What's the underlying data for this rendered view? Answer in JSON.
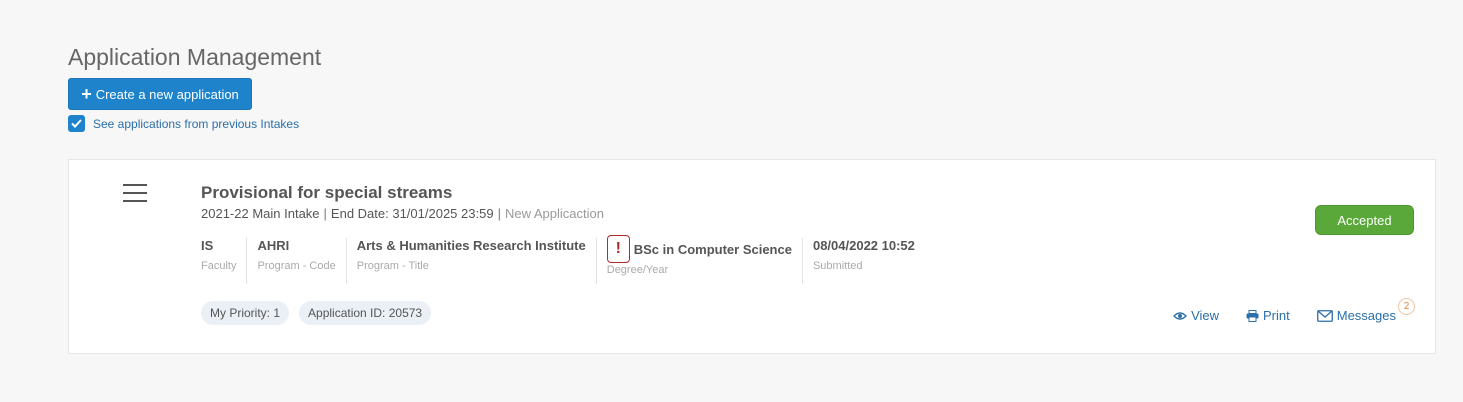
{
  "page": {
    "title": "Application Management"
  },
  "toolbar": {
    "create_label": "Create a new application",
    "prev_intakes_label": "See applications from previous Intakes",
    "prev_intakes_checked": true
  },
  "application": {
    "title": "Provisional for special streams",
    "intake": "2021-22 Main Intake",
    "end_date": "End Date: 31/01/2025 23:59",
    "type": "New Applicaction",
    "fields": {
      "faculty": {
        "value": "IS",
        "label": "Faculty"
      },
      "program_code": {
        "value": "AHRI",
        "label": "Program - Code"
      },
      "program_title": {
        "value": "Arts & Humanities Research Institute",
        "label": "Program - Title"
      },
      "degree": {
        "value": "BSc in Computer Science",
        "label": "Degree/Year",
        "warning": "!"
      },
      "submitted": {
        "value": "08/04/2022 10:52",
        "label": "Submitted"
      }
    },
    "badges": {
      "priority": "My Priority: 1",
      "application_id": "Application ID: 20573"
    },
    "status": "Accepted",
    "status_color": "#5aa83a",
    "actions": {
      "view": "View",
      "print": "Print",
      "messages": "Messages",
      "messages_count": "2"
    }
  },
  "colors": {
    "accent": "#1f83cc",
    "link": "#2a6fa8",
    "warning": "#b02a2a"
  }
}
